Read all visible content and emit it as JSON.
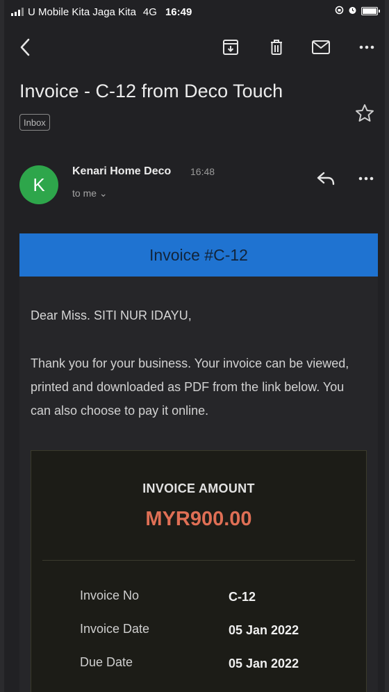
{
  "status_bar": {
    "carrier": "U Mobile Kita Jaga Kita",
    "network": "4G",
    "time": "16:49"
  },
  "toolbar": {
    "icons": [
      "back-arrow-icon",
      "archive-icon",
      "delete-icon",
      "mark-unread-icon",
      "more-icon"
    ]
  },
  "email": {
    "subject": "Invoice - C-12 from Deco Touch",
    "label": "Inbox",
    "sender": {
      "avatar_letter": "K",
      "avatar_color": "#2ea64b",
      "name": "Kenari Home Deco",
      "time": "16:48",
      "recipient": "to me ⌄"
    },
    "body": {
      "banner_title": "Invoice #C-12",
      "banner_color": "#1f73d1",
      "greeting": "Dear Miss. SITI NUR IDAYU,",
      "message": "Thank you for your business. Your invoice can be viewed, printed and downloaded as PDF from the link below. You can also choose to pay it online.",
      "invoice": {
        "amount_label": "INVOICE AMOUNT",
        "amount": "MYR900.00",
        "amount_color": "#df6f55",
        "details": [
          {
            "key": "Invoice No",
            "value": "C-12"
          },
          {
            "key": "Invoice Date",
            "value": "05 Jan 2022"
          },
          {
            "key": "Due Date",
            "value": "05 Jan 2022"
          }
        ]
      }
    }
  }
}
